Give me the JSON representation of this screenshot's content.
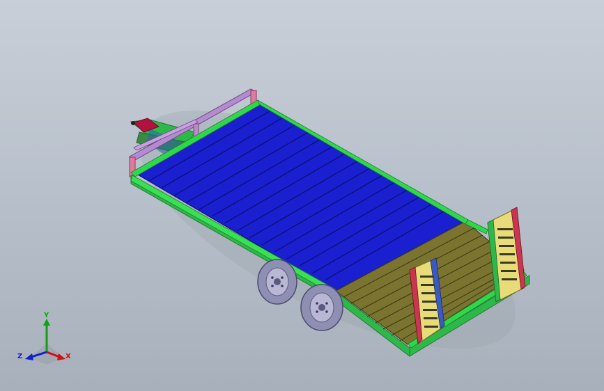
{
  "viewport": {
    "background_top": "#c9cfd8",
    "background_bottom": "#a8b0bb"
  },
  "model": {
    "name": "flatbed-trailer",
    "colors": {
      "deck_blue": "#1a1fd0",
      "deck_lines": "#0a0e6a",
      "rear_deck_olive": "#7a7430",
      "frame_green": "#2fb84a",
      "frame_dark": "#1e7a32",
      "rail_purple": "#b48ad0",
      "rail_pink": "#e07aa0",
      "hitch_red": "#b3123e",
      "ramp_red": "#c8374f",
      "ramp_yellow": "#e8dc7a",
      "tire_gray": "#8f8fb4",
      "tire_dark": "#5a5a80"
    }
  },
  "triad": {
    "x_label": "X",
    "y_label": "Y",
    "z_label": "Z",
    "x_color": "#d01010",
    "y_color": "#10a010",
    "z_color": "#1020d0"
  }
}
